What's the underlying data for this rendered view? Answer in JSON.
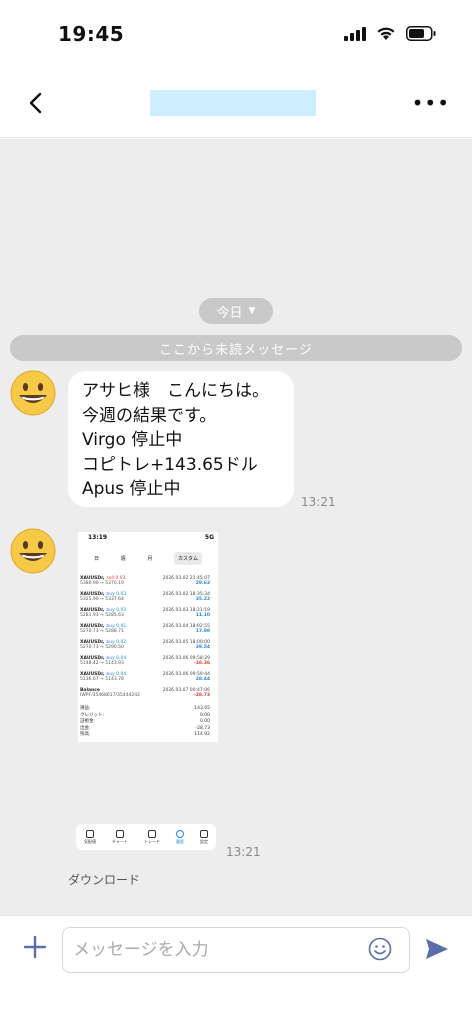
{
  "status_bar": {
    "time": "19:45",
    "icons": [
      "signal-icon",
      "wifi-icon",
      "battery-icon"
    ]
  },
  "nav": {
    "back_icon": "chevron-left-icon",
    "more_icon": "more-horizontal-icon",
    "more_label": "•••"
  },
  "chat": {
    "date_label": "今日",
    "unread_label": "ここから未読メッセージ",
    "messages": [
      {
        "sender_icon": "grinning-face-avatar",
        "lines": [
          "アサヒ様　こんにちは。",
          "今週の結果です。",
          "Virgo  停止中",
          "コピトレ+143.65ドル",
          "Apus  停止中"
        ],
        "time": "13:21"
      },
      {
        "sender_icon": "grinning-face-avatar",
        "type": "image",
        "time": "13:21",
        "download_label": "ダウンロード"
      }
    ]
  },
  "screenshot": {
    "time": "13:19",
    "status_right": "5G",
    "tabs": [
      "日",
      "週",
      "月",
      "カスタム"
    ],
    "rows": [
      {
        "symbol": "XAUUSDr,",
        "side": "sell 0.03",
        "side_type": "sell",
        "date": "2026.03.02 21:45:07",
        "prices": "5380.90 → 5370.19",
        "profit": "29.63"
      },
      {
        "symbol": "XAUUSDr,",
        "side": "buy 0.03",
        "side_type": "buy",
        "date": "2026.03.02 18:35:34",
        "prices": "5325.90 → 5337.64",
        "profit": "35.22"
      },
      {
        "symbol": "XAUUSDr,",
        "side": "buy 0.03",
        "side_type": "buy",
        "date": "2026.03.03 18:21:19",
        "prices": "5281.93 → 5285.63",
        "profit": "11.10"
      },
      {
        "symbol": "XAUUSDr,",
        "side": "buy 0.01",
        "side_type": "buy",
        "date": "2026.03.04 18:02:55",
        "prices": "5270.73 → 5288.71",
        "profit": "17.98"
      },
      {
        "symbol": "XAUUSDr,",
        "side": "buy 0.02",
        "side_type": "buy",
        "date": "2026.03.05 18:00:00",
        "prices": "5270.73 → 5290.50",
        "profit": "39.54"
      },
      {
        "symbol": "XAUUSDr,",
        "side": "buy 0.04",
        "side_type": "buy",
        "date": "2026.03.06 09:58:29",
        "prices": "5148.42 → 5143.93",
        "profit": "-18.36"
      },
      {
        "symbol": "XAUUSDr,",
        "side": "buy 0.04",
        "side_type": "buy",
        "date": "2026.03.06 09:59:44",
        "prices": "5136.67 → 5143.78",
        "profit": "28.44"
      }
    ],
    "balance": {
      "label": "Balance",
      "date": "2026.03.07 00:47:06",
      "account": "IWPF/35468617/35444242",
      "value": "-28.73"
    },
    "summary": [
      {
        "label": "損益:",
        "value": "143.65"
      },
      {
        "label": "クレジット:",
        "value": "0.00"
      },
      {
        "label": "証拠金:",
        "value": "0.00"
      },
      {
        "label": "出金:",
        "value": "-28.73"
      },
      {
        "label": "残高:",
        "value": "114.92"
      }
    ],
    "toolbar": [
      "気配値",
      "チャート",
      "トレード",
      "履歴",
      "設定"
    ],
    "toolbar_active": 3
  },
  "input": {
    "placeholder": "メッセージを入力",
    "value": ""
  },
  "colors": {
    "chat_background": "#ededed",
    "pill": "#c8c8c8",
    "title_placeholder": "#cdeeff",
    "send_icon": "#5b6fa6",
    "sell": "#e53935",
    "buy": "#1e88e5"
  }
}
